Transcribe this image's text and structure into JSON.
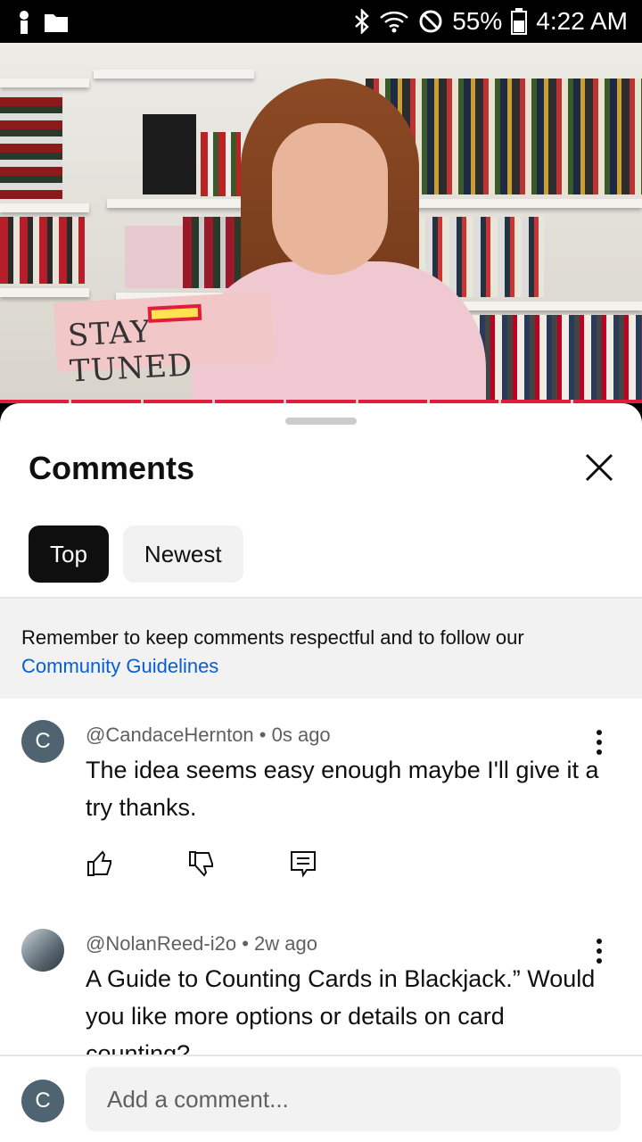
{
  "status_bar": {
    "battery": "55%",
    "time": "4:22 AM",
    "icons": [
      "person-icon",
      "folder-icon",
      "bluetooth-icon",
      "wifi-icon",
      "do-not-disturb-icon",
      "battery-icon"
    ]
  },
  "video": {
    "overlay_text": "STAY TUNED",
    "accent_color": "#e11d3f"
  },
  "comments_panel": {
    "title": "Comments",
    "tabs": [
      {
        "label": "Top",
        "active": true
      },
      {
        "label": "Newest",
        "active": false
      }
    ],
    "notice": {
      "text": "Remember to keep comments respectful and to follow our ",
      "link": "Community Guidelines"
    },
    "comments": [
      {
        "avatar_letter": "C",
        "author": "@CandaceHernton",
        "time": "0s ago",
        "text": "The idea seems easy enough maybe I'll give it a try thanks."
      },
      {
        "avatar_letter": "",
        "author": "@NolanReed-i2o",
        "time": "2w ago",
        "text": "A Guide to Counting Cards in Blackjack.” Would you like more options or details on card counting?"
      }
    ],
    "add_comment": {
      "avatar_letter": "C",
      "placeholder": "Add a comment..."
    }
  }
}
